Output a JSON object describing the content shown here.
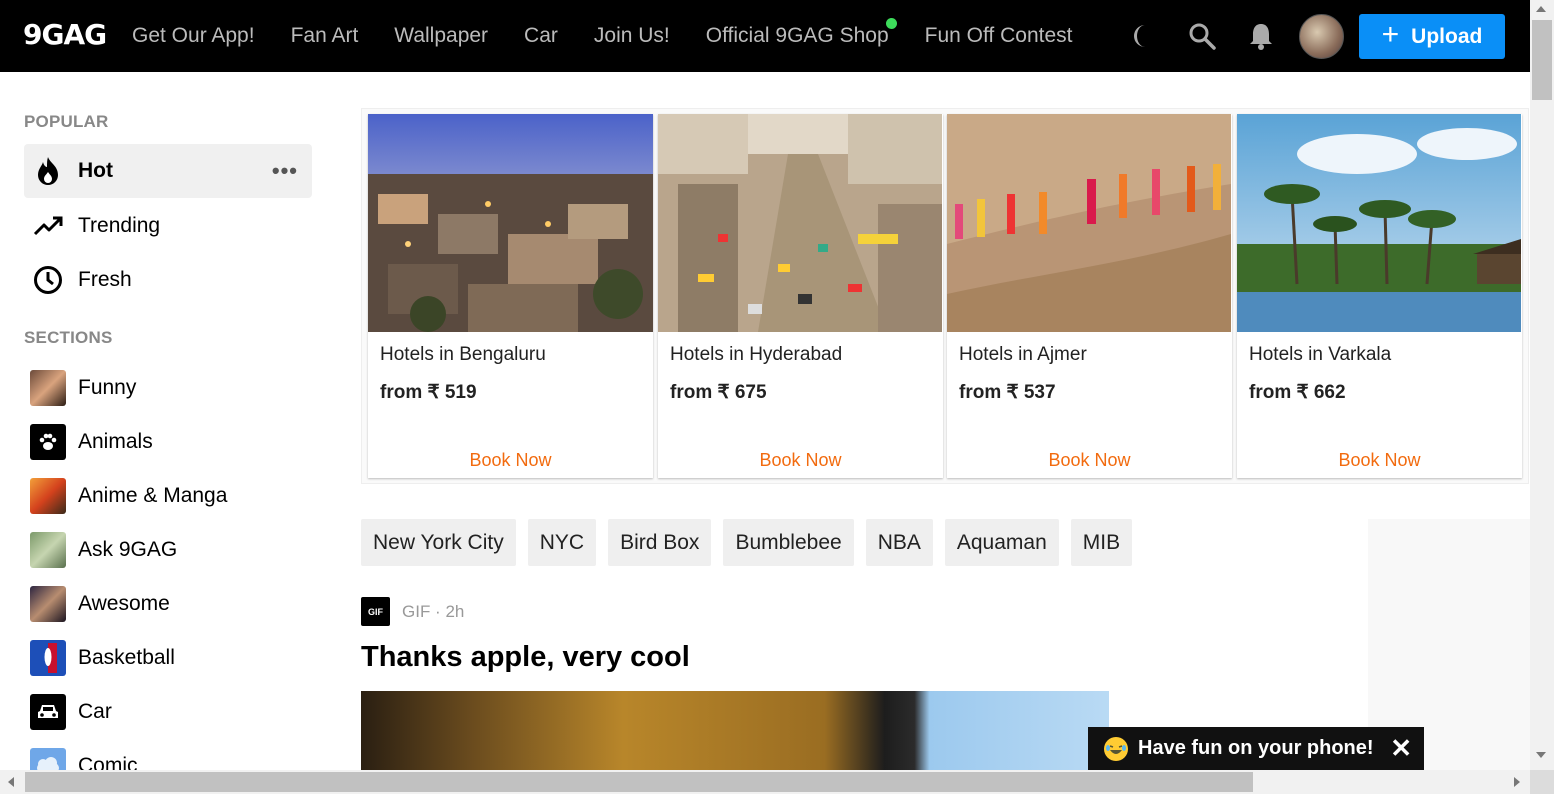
{
  "header": {
    "logo": "9GAG",
    "nav": [
      {
        "label": "Get Our App!"
      },
      {
        "label": "Fan Art"
      },
      {
        "label": "Wallpaper"
      },
      {
        "label": "Car"
      },
      {
        "label": "Join Us!"
      },
      {
        "label": "Official 9GAG Shop",
        "dot": true
      },
      {
        "label": "Fun Off Contest"
      }
    ],
    "icons": [
      "moon-icon",
      "search-icon",
      "bell-icon"
    ],
    "upload_label": "Upload",
    "upload_color": "#0a8ff7"
  },
  "sidebar": {
    "popular_title": "POPULAR",
    "popular": [
      {
        "label": "Hot",
        "icon": "flame-icon",
        "active": true
      },
      {
        "label": "Trending",
        "icon": "trending-icon"
      },
      {
        "label": "Fresh",
        "icon": "clock-icon"
      }
    ],
    "sections_title": "SECTIONS",
    "sections": [
      {
        "label": "Funny",
        "icon": "funny-section-icon"
      },
      {
        "label": "Animals",
        "icon": "paw-icon"
      },
      {
        "label": "Anime & Manga",
        "icon": "anime-section-icon"
      },
      {
        "label": "Ask 9GAG",
        "icon": "ask-section-icon"
      },
      {
        "label": "Awesome",
        "icon": "awesome-section-icon"
      },
      {
        "label": "Basketball",
        "icon": "nba-logo-icon"
      },
      {
        "label": "Car",
        "icon": "car-icon"
      },
      {
        "label": "Comic",
        "icon": "comic-cloud-icon"
      }
    ]
  },
  "ad": {
    "hotels": [
      {
        "name": "Hotels in Bengaluru",
        "price": "from ₹ 519",
        "cta": "Book Now"
      },
      {
        "name": "Hotels in Hyderabad",
        "price": "from ₹ 675",
        "cta": "Book Now"
      },
      {
        "name": "Hotels in Ajmer",
        "price": "from ₹ 537",
        "cta": "Book Now"
      },
      {
        "name": "Hotels in Varkala",
        "price": "from ₹ 662",
        "cta": "Book Now"
      }
    ],
    "cta_color": "#f26b0f"
  },
  "tags": [
    "New York City",
    "NYC",
    "Bird Box",
    "Bumblebee",
    "NBA",
    "Aquaman",
    "MIB"
  ],
  "post": {
    "badge": "GIF",
    "meta": "GIF · 2h",
    "title": "Thanks apple, very cool"
  },
  "promo": {
    "text": "Have fun on your phone!",
    "close": "✕"
  }
}
